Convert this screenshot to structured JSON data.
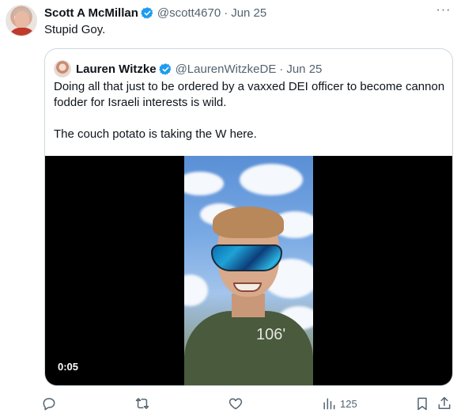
{
  "tweet": {
    "author_name": "Scott A McMillan",
    "handle": "@scott4670",
    "date": "Jun 25",
    "separator": "·",
    "text": "Stupid Goy.",
    "more_label": "···"
  },
  "quote": {
    "author_name": "Lauren Witzke",
    "handle": "@LaurenWitzkeDE",
    "date": "Jun 25",
    "separator": "·",
    "paragraphs": [
      "Doing all that just to be ordered by a vaxxed DEI officer to become cannon fodder for Israeli interests is wild.",
      "The couch potato is taking the W here."
    ],
    "video": {
      "timestamp": "0:05",
      "overlay_number": "106'"
    }
  },
  "actions": {
    "views": "125"
  },
  "colors": {
    "verified": "#1d9bf0",
    "secondary_text": "#536471",
    "border": "#cfd9de"
  }
}
